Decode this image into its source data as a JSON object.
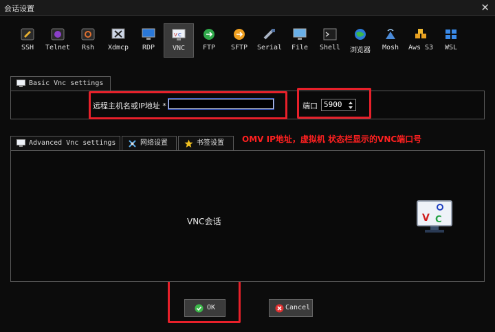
{
  "window": {
    "title": "会话设置",
    "close_glyph": "✕"
  },
  "protocols": [
    {
      "label": "SSH",
      "icon": "ssh-icon"
    },
    {
      "label": "Telnet",
      "icon": "telnet-icon"
    },
    {
      "label": "Rsh",
      "icon": "rsh-icon"
    },
    {
      "label": "Xdmcp",
      "icon": "xdmcp-icon"
    },
    {
      "label": "RDP",
      "icon": "rdp-icon"
    },
    {
      "label": "VNC",
      "icon": "vnc-icon",
      "selected": true
    },
    {
      "label": "FTP",
      "icon": "ftp-icon"
    },
    {
      "label": "SFTP",
      "icon": "sftp-icon"
    },
    {
      "label": "Serial",
      "icon": "serial-icon"
    },
    {
      "label": "File",
      "icon": "file-icon"
    },
    {
      "label": "Shell",
      "icon": "shell-icon"
    },
    {
      "label": "浏览器",
      "icon": "browser-icon"
    },
    {
      "label": "Mosh",
      "icon": "mosh-icon"
    },
    {
      "label": "Aws S3",
      "icon": "aws-s3-icon"
    },
    {
      "label": "WSL",
      "icon": "wsl-icon"
    }
  ],
  "basic": {
    "tab_label": "Basic Vnc settings",
    "host_label": "远程主机名或IP地址 *",
    "host_value": "",
    "port_label": "端口",
    "port_value": "5900"
  },
  "advanced_tabs": [
    {
      "label": "Advanced Vnc settings",
      "icon": "vnc-small-icon"
    },
    {
      "label": "网络设置",
      "icon": "network-icon"
    },
    {
      "label": "书签设置",
      "icon": "star-icon"
    }
  ],
  "annotation": "OMV IP地址，虚拟机 状态栏显示的VNC端口号",
  "session_label": "VNC会话",
  "buttons": {
    "ok": "OK",
    "cancel": "Cancel"
  },
  "colors": {
    "accent_red": "#e8202a",
    "selected_tab": "#3a3a3a",
    "background": "#0c0c0c"
  }
}
